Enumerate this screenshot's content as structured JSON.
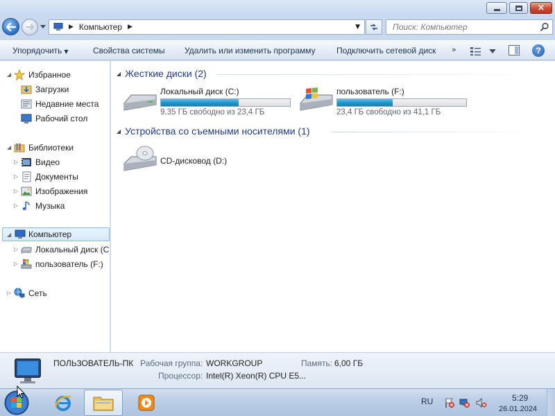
{
  "window": {
    "buttons": {
      "minimize": "minimize",
      "maximize": "maximize",
      "close": "×"
    }
  },
  "address": {
    "path": "Компьютер",
    "search_placeholder": "Поиск: Компьютер"
  },
  "commands": {
    "organize": "Упорядочить",
    "system_properties": "Свойства системы",
    "uninstall": "Удалить или изменить программу",
    "map_drive": "Подключить сетевой диск",
    "more": "»"
  },
  "nav": {
    "favorites": "Избранное",
    "downloads": "Загрузки",
    "recent": "Недавние места",
    "desktop": "Рабочий стол",
    "libraries": "Библиотеки",
    "video": "Видео",
    "documents": "Документы",
    "pictures": "Изображения",
    "music": "Музыка",
    "computer": "Компьютер",
    "local_disk": "Локальный диск (C",
    "user_drive": "пользователь (F:)",
    "network": "Сеть"
  },
  "groups": {
    "hard_disks": "Жесткие диски (2)",
    "removable": "Устройства со съемными носителями (1)"
  },
  "drives": [
    {
      "name": "Локальный диск (C:)",
      "free_text": "9,35 ГБ свободно из 23,4 ГБ",
      "used_fraction": 0.6
    },
    {
      "name": "пользователь (F:)",
      "free_text": "23,4 ГБ свободно из 41,1 ГБ",
      "used_fraction": 0.43
    }
  ],
  "removable_drives": [
    {
      "name": "CD-дисковод (D:)"
    }
  ],
  "details": {
    "pc_name": "ПОЛЬЗОВАТЕЛЬ-ПК",
    "workgroup_label": "Рабочая группа:",
    "workgroup_value": "WORKGROUP",
    "memory_label": "Память:",
    "memory_value": "6,00 ГБ",
    "cpu_label": "Процессор:",
    "cpu_value": "Intel(R) Xeon(R) CPU E5..."
  },
  "taskbar": {
    "language": "RU",
    "time": "5:29",
    "date": "26.01.2024"
  },
  "colors": {
    "accent": "#1e3d82",
    "bar_fill": "#1f93c6",
    "selection": "#d6e8fb"
  }
}
